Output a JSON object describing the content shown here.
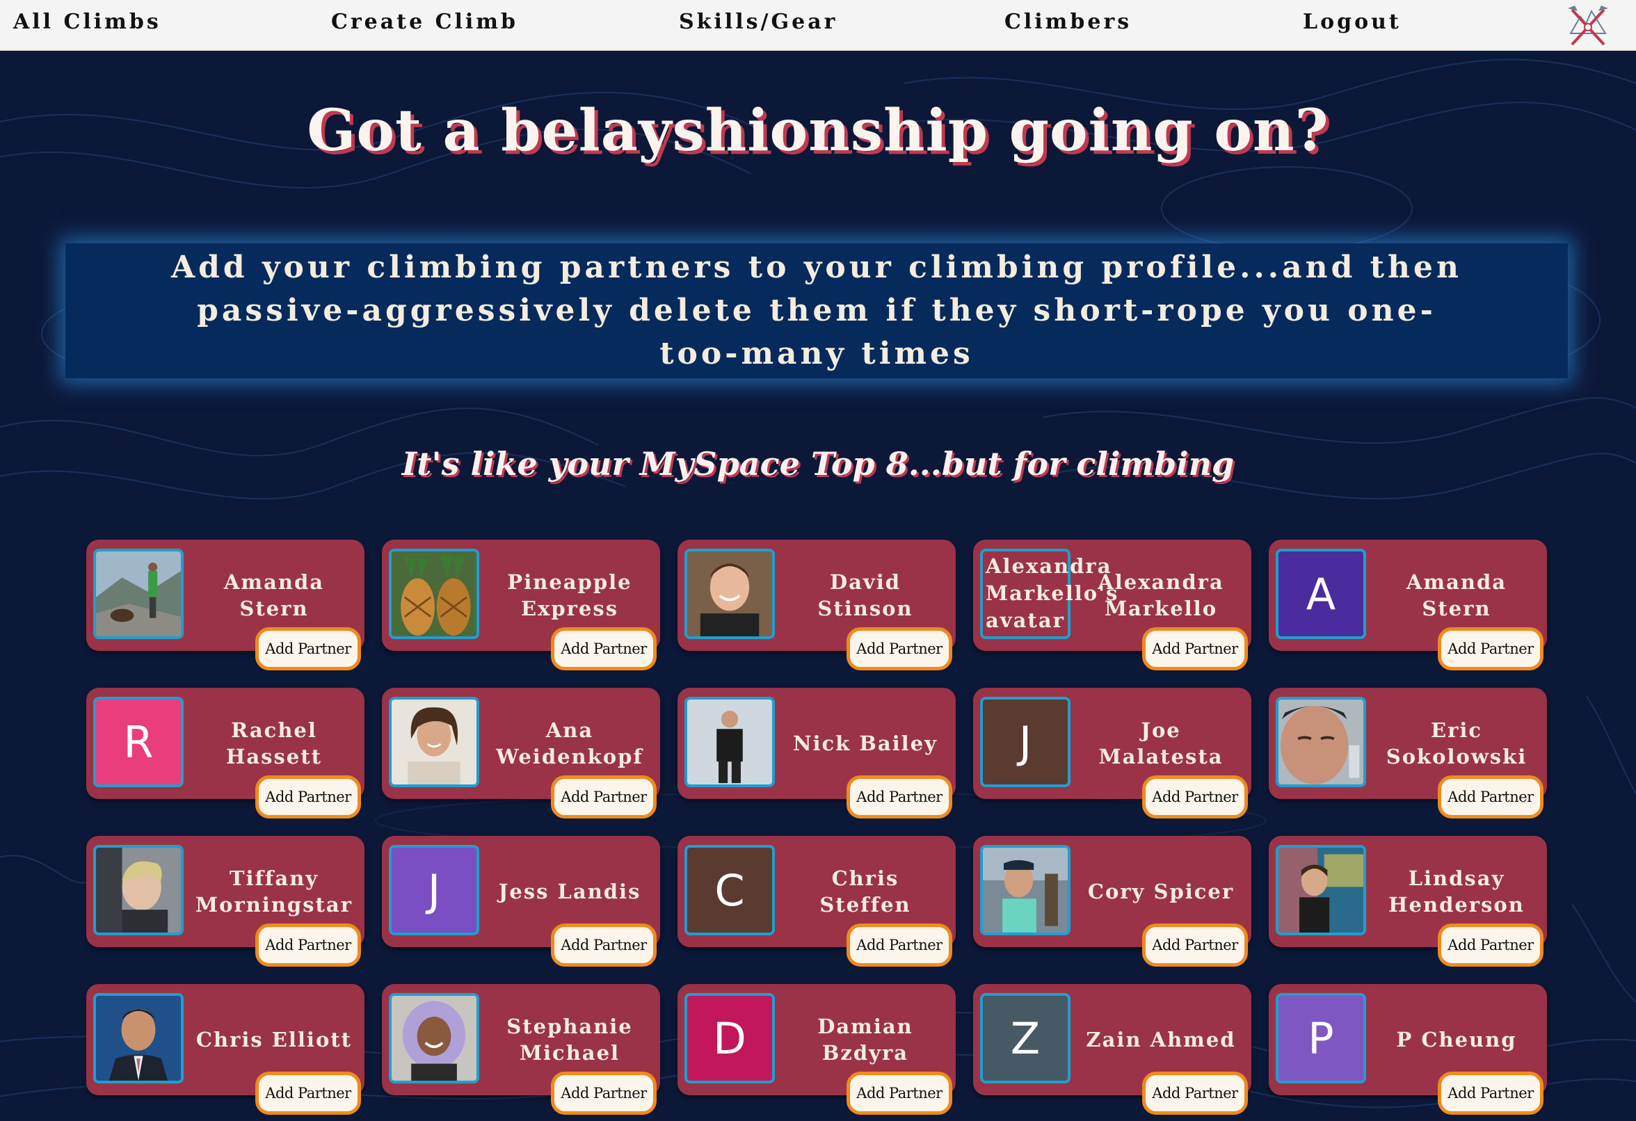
{
  "nav": {
    "links": [
      "All Climbs",
      "Create Climb",
      "Skills/Gear",
      "Climbers",
      "Logout"
    ]
  },
  "header": {
    "title": "Got a belayshionship going on?",
    "banner": "Add your climbing partners to your climbing profile...and then passive-aggressively delete them if they short-rope you one-too-many times",
    "subtitle": "It's like your MySpace Top 8...but for climbing"
  },
  "button_label": "Add Partner",
  "climbers": [
    {
      "name": "Amanda Stern",
      "avatar": {
        "type": "photo",
        "scene": "mountain-hiker-photo"
      }
    },
    {
      "name": "Pineapple Express",
      "avatar": {
        "type": "photo",
        "scene": "pineapples-photo"
      }
    },
    {
      "name": "David Stinson",
      "avatar": {
        "type": "photo",
        "scene": "smiling-man-photo"
      }
    },
    {
      "name": "Alexandra Markello",
      "avatar": {
        "type": "broken",
        "alt": "Alexandra Markello's avatar"
      }
    },
    {
      "name": "Amanda Stern",
      "avatar": {
        "type": "letter",
        "letter": "A",
        "color": "#4a2c9f"
      }
    },
    {
      "name": "Rachel Hassett",
      "avatar": {
        "type": "letter",
        "letter": "R",
        "color": "#ea3d7c"
      }
    },
    {
      "name": "Ana Weidenkopf",
      "avatar": {
        "type": "photo",
        "scene": "smiling-woman-photo"
      }
    },
    {
      "name": "Nick Bailey",
      "avatar": {
        "type": "photo",
        "scene": "standing-man-photo"
      }
    },
    {
      "name": "Joe Malatesta",
      "avatar": {
        "type": "letter",
        "letter": "J",
        "color": "#5b3a30"
      }
    },
    {
      "name": "Eric Sokolowski",
      "avatar": {
        "type": "photo",
        "scene": "closeup-face-photo"
      }
    },
    {
      "name": "Tiffany Morningstar",
      "avatar": {
        "type": "photo",
        "scene": "car-selfie-photo"
      }
    },
    {
      "name": "Jess Landis",
      "avatar": {
        "type": "letter",
        "letter": "J",
        "color": "#7b4fc3"
      }
    },
    {
      "name": "Chris Steffen",
      "avatar": {
        "type": "letter",
        "letter": "C",
        "color": "#5b3a30"
      }
    },
    {
      "name": "Cory Spicer",
      "avatar": {
        "type": "photo",
        "scene": "street-man-photo"
      }
    },
    {
      "name": "Lindsay Henderson",
      "avatar": {
        "type": "photo",
        "scene": "mural-woman-photo"
      }
    },
    {
      "name": "Chris Elliott",
      "avatar": {
        "type": "photo",
        "scene": "suit-portrait-photo"
      }
    },
    {
      "name": "Stephanie Michael",
      "avatar": {
        "type": "photo",
        "scene": "purple-hair-photo"
      }
    },
    {
      "name": "Damian Bzdyra",
      "avatar": {
        "type": "letter",
        "letter": "D",
        "color": "#c2185b"
      }
    },
    {
      "name": "Zain Ahmed",
      "avatar": {
        "type": "letter",
        "letter": "Z",
        "color": "#455a64"
      }
    },
    {
      "name": "P Cheung",
      "avatar": {
        "type": "letter",
        "letter": "P",
        "color": "#7e57c2"
      }
    }
  ],
  "colors": {
    "background": "#0c1838",
    "card": "#9a3347",
    "accent_shadow": "#c0394f",
    "button_border": "#f08a1c",
    "avatar_border": "#1e9fd0",
    "banner": "#062a5b"
  }
}
